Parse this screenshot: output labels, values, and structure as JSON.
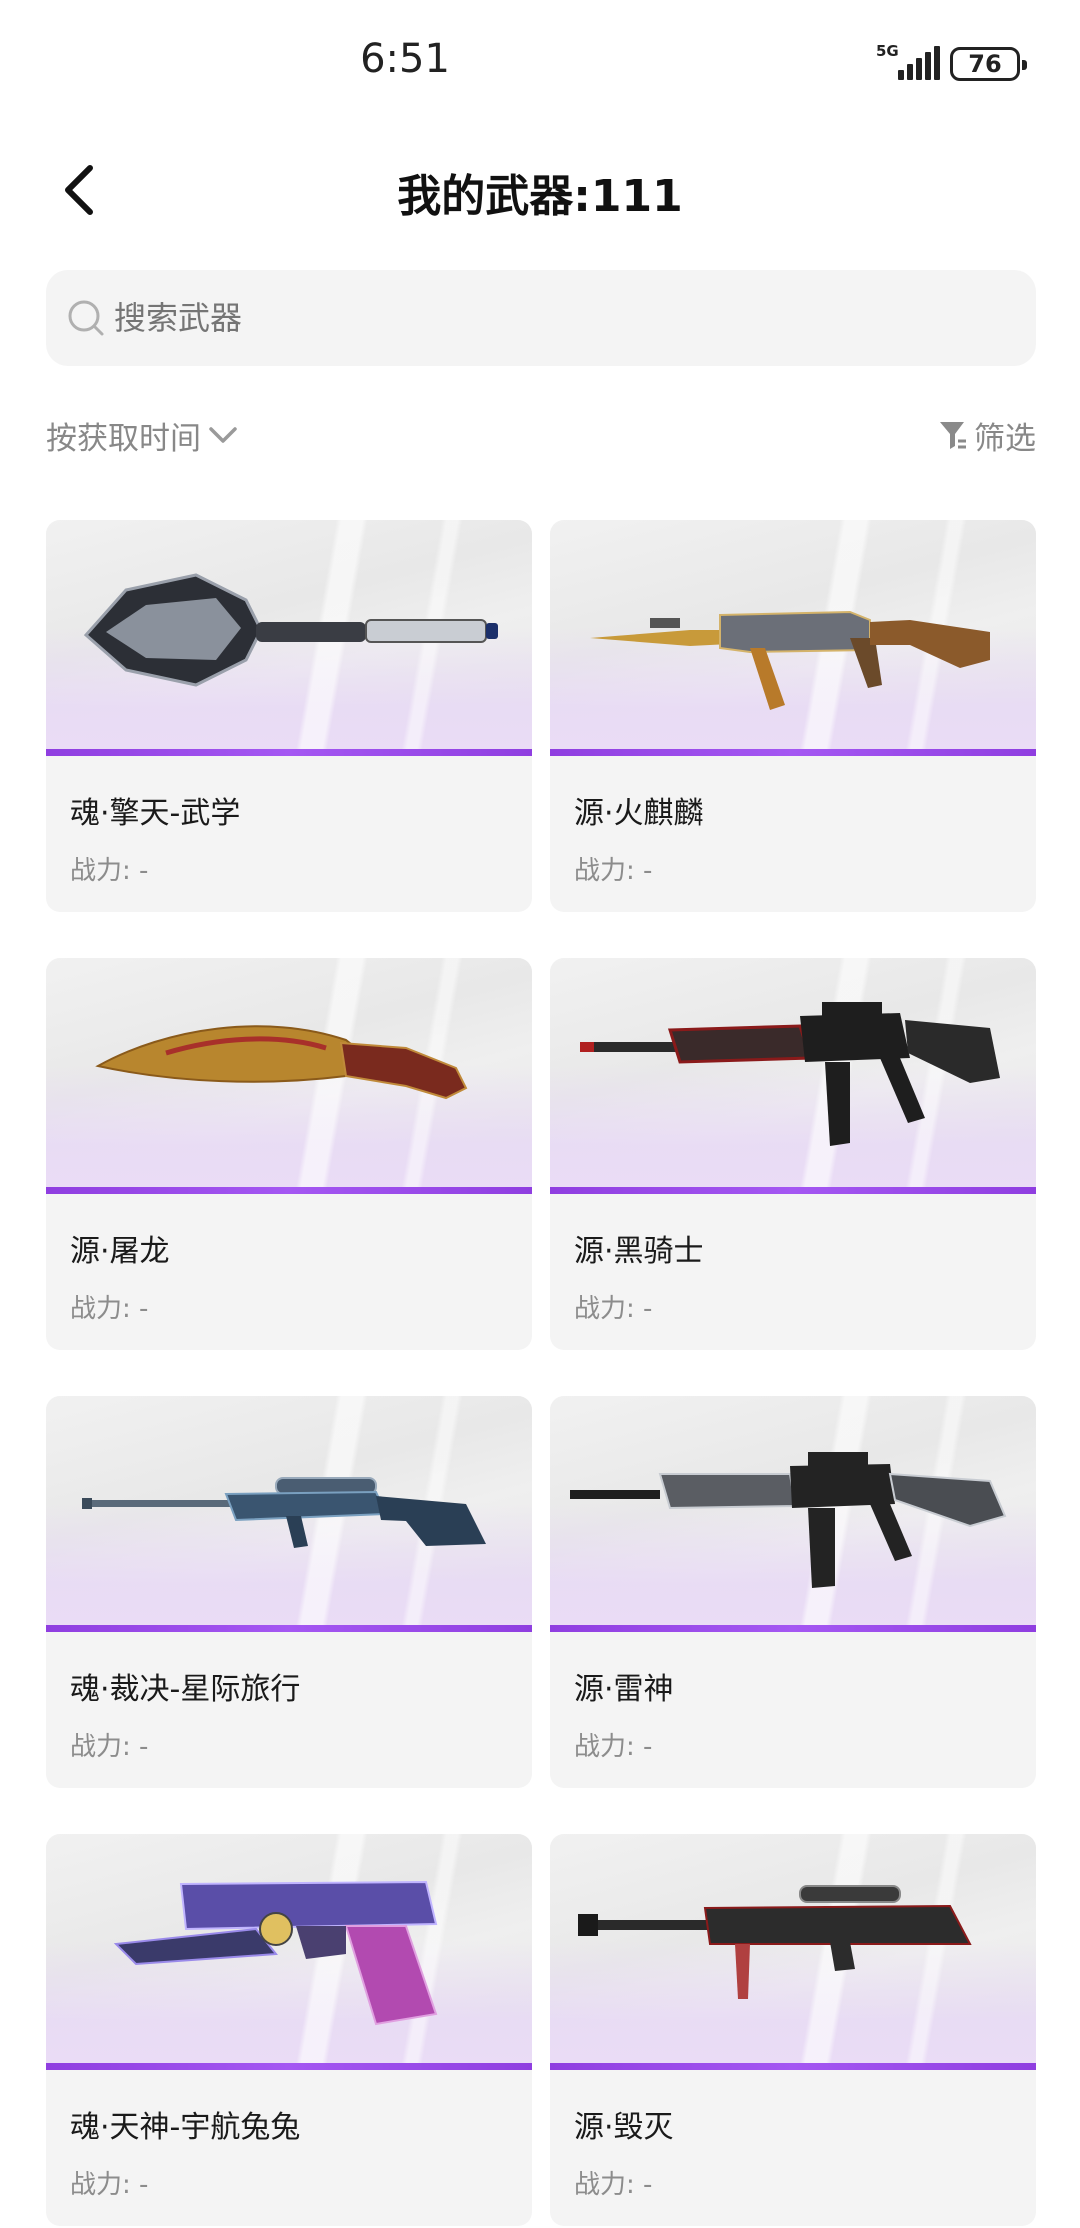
{
  "status_bar": {
    "time": "6:51",
    "network": "5G",
    "battery": "76"
  },
  "header": {
    "title": "我的武器:111",
    "back_icon": "chevron-left-icon"
  },
  "search": {
    "placeholder": "搜索武器",
    "icon": "search-icon"
  },
  "sort": {
    "label": "按获取时间",
    "icon": "chevron-down-icon"
  },
  "filter": {
    "label": "筛选",
    "icon": "funnel-icon"
  },
  "colors": {
    "accent_purple": "#9b4be8",
    "card_bg": "#f4f4f4",
    "muted_text": "#8c8c8c"
  },
  "weapons": [
    {
      "name": "魂·擎天-武学",
      "power": "战力: -"
    },
    {
      "name": "源·火麒麟",
      "power": "战力: -"
    },
    {
      "name": "源·屠龙",
      "power": "战力: -"
    },
    {
      "name": "源·黑骑士",
      "power": "战力: -"
    },
    {
      "name": "魂·裁决-星际旅行",
      "power": "战力: -"
    },
    {
      "name": "源·雷神",
      "power": "战力: -"
    },
    {
      "name": "魂·天神-宇航兔兔",
      "power": "战力: -"
    },
    {
      "name": "源·毁灭",
      "power": "战力: -"
    }
  ]
}
